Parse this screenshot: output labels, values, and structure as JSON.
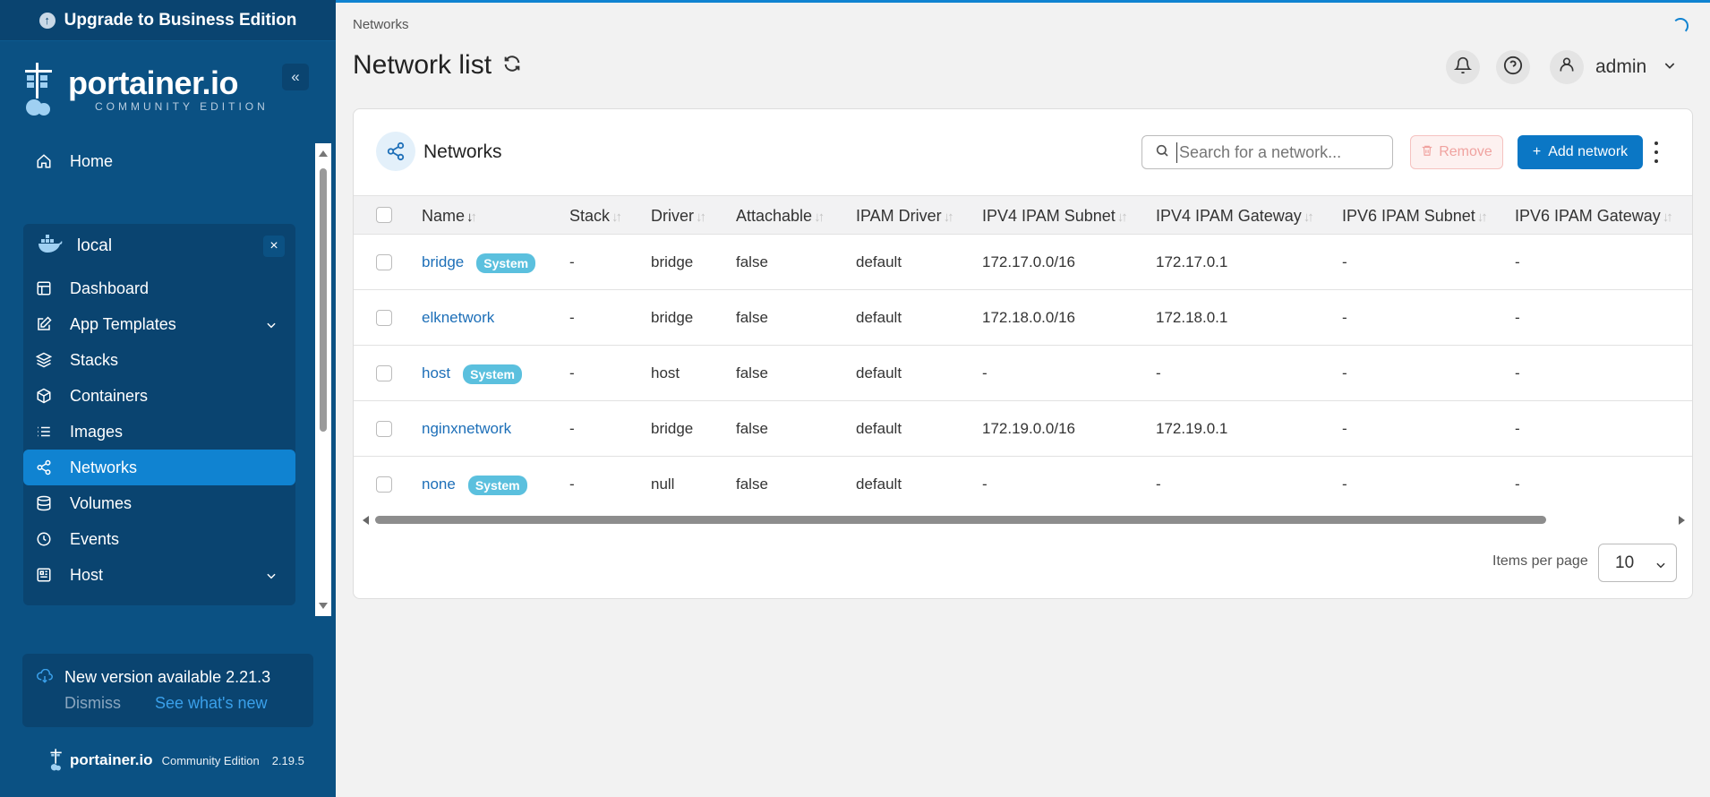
{
  "sidebar": {
    "upgrade_label": "Upgrade to Business Edition",
    "brand_name": "portainer.io",
    "brand_sub": "COMMUNITY EDITION",
    "home_label": "Home",
    "environment": {
      "name": "local"
    },
    "items": [
      {
        "label": "Dashboard",
        "icon": "layout-icon"
      },
      {
        "label": "App Templates",
        "icon": "edit-icon"
      },
      {
        "label": "Stacks",
        "icon": "layers-icon"
      },
      {
        "label": "Containers",
        "icon": "box-icon"
      },
      {
        "label": "Images",
        "icon": "list-icon"
      },
      {
        "label": "Networks",
        "icon": "share-icon",
        "active": true
      },
      {
        "label": "Volumes",
        "icon": "database-icon"
      },
      {
        "label": "Events",
        "icon": "clock-icon"
      },
      {
        "label": "Host",
        "icon": "host-icon"
      }
    ],
    "update": {
      "title": "New version available 2.21.3",
      "dismiss": "Dismiss",
      "see_new": "See what's new"
    },
    "footer": {
      "name": "portainer.io",
      "edition": "Community Edition",
      "version": "2.19.5"
    }
  },
  "header": {
    "breadcrumb": "Networks",
    "title": "Network list",
    "user": "admin"
  },
  "card": {
    "title": "Networks",
    "search_placeholder": "Search for a network...",
    "remove_label": "Remove",
    "add_label": "Add network"
  },
  "table": {
    "columns": [
      "Name",
      "Stack",
      "Driver",
      "Attachable",
      "IPAM Driver",
      "IPV4 IPAM Subnet",
      "IPV4 IPAM Gateway",
      "IPV6 IPAM Subnet",
      "IPV6 IPAM Gateway"
    ],
    "system_badge": "System",
    "rows": [
      {
        "name": "bridge",
        "system": true,
        "stack": "-",
        "driver": "bridge",
        "attachable": "false",
        "ipam": "default",
        "v4subnet": "172.17.0.0/16",
        "v4gw": "172.17.0.1",
        "v6subnet": "-",
        "v6gw": "-"
      },
      {
        "name": "elknetwork",
        "system": false,
        "stack": "-",
        "driver": "bridge",
        "attachable": "false",
        "ipam": "default",
        "v4subnet": "172.18.0.0/16",
        "v4gw": "172.18.0.1",
        "v6subnet": "-",
        "v6gw": "-"
      },
      {
        "name": "host",
        "system": true,
        "stack": "-",
        "driver": "host",
        "attachable": "false",
        "ipam": "default",
        "v4subnet": "-",
        "v4gw": "-",
        "v6subnet": "-",
        "v6gw": "-"
      },
      {
        "name": "nginxnetwork",
        "system": false,
        "stack": "-",
        "driver": "bridge",
        "attachable": "false",
        "ipam": "default",
        "v4subnet": "172.19.0.0/16",
        "v4gw": "172.19.0.1",
        "v6subnet": "-",
        "v6gw": "-"
      },
      {
        "name": "none",
        "system": true,
        "stack": "-",
        "driver": "null",
        "attachable": "false",
        "ipam": "default",
        "v4subnet": "-",
        "v4gw": "-",
        "v6subnet": "-",
        "v6gw": "-"
      }
    ]
  },
  "pagination": {
    "label": "Items per page",
    "value": "10"
  },
  "colors": {
    "sidebar": "#0b5183",
    "accent": "#1083d1",
    "link": "#1d6fb8",
    "badge": "#5bc0de"
  }
}
